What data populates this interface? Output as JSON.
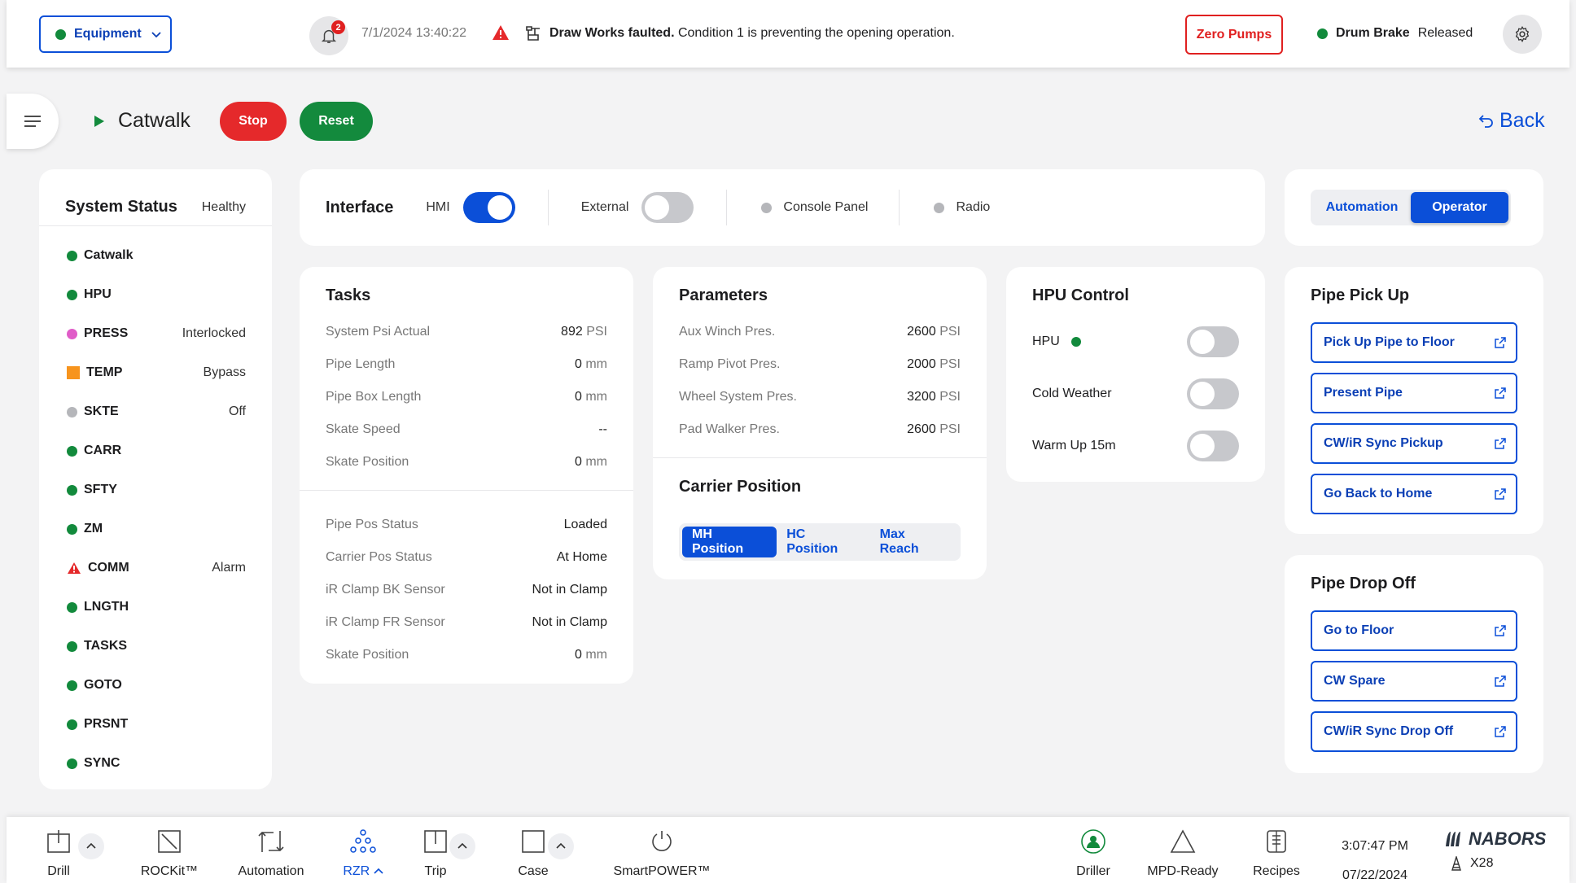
{
  "header": {
    "equipment_label": "Equipment",
    "notification_count": "2",
    "timestamp": "7/1/2024  13:40:22",
    "alert_title": "Draw Works faulted.",
    "alert_message": " Condition 1 is preventing the opening operation.",
    "zero_pumps": "Zero Pumps",
    "drum_brake_label": "Drum Brake",
    "drum_brake_state": "Released"
  },
  "page": {
    "title": "Catwalk",
    "stop": "Stop",
    "reset": "Reset",
    "back": "Back"
  },
  "system_status": {
    "title": "System Status",
    "state": "Healthy",
    "items": [
      {
        "name": "CATWALK",
        "display": "Catwalk",
        "status": "",
        "indicator": "green"
      },
      {
        "name": "HPU",
        "display": "HPU",
        "status": "",
        "indicator": "green"
      },
      {
        "name": "PRESS",
        "display": "PRESS",
        "status": "Interlocked",
        "indicator": "magenta"
      },
      {
        "name": "TEMP",
        "display": "TEMP",
        "status": "Bypass",
        "indicator": "orange-square"
      },
      {
        "name": "SKTE",
        "display": "SKTE",
        "status": "Off",
        "indicator": "gray"
      },
      {
        "name": "CARR",
        "display": "CARR",
        "status": "",
        "indicator": "green"
      },
      {
        "name": "SFTY",
        "display": "SFTY",
        "status": "",
        "indicator": "green"
      },
      {
        "name": "ZM",
        "display": "ZM",
        "status": "",
        "indicator": "green"
      },
      {
        "name": "COMM",
        "display": "COMM",
        "status": "Alarm",
        "indicator": "red-triangle"
      },
      {
        "name": "LNGTH",
        "display": "LNGTH",
        "status": "",
        "indicator": "green"
      },
      {
        "name": "TASKS",
        "display": "TASKS",
        "status": "",
        "indicator": "green"
      },
      {
        "name": "GOTO",
        "display": "GOTO",
        "status": "",
        "indicator": "green"
      },
      {
        "name": "PRSNT",
        "display": "PRSNT",
        "status": "",
        "indicator": "green"
      },
      {
        "name": "SYNC",
        "display": "SYNC",
        "status": "",
        "indicator": "green"
      }
    ]
  },
  "interface": {
    "title": "Interface",
    "hmi_label": "HMI",
    "hmi_on": true,
    "external_label": "External",
    "external_on": false,
    "console_label": "Console Panel",
    "radio_label": "Radio"
  },
  "mode": {
    "automation": "Automation",
    "operator": "Operator",
    "active": "Operator"
  },
  "tasks": {
    "title": "Tasks",
    "rows1": [
      {
        "k": "System Psi Actual",
        "v": "892",
        "u": "PSI"
      },
      {
        "k": "Pipe Length",
        "v": "0",
        "u": "mm"
      },
      {
        "k": "Pipe Box Length",
        "v": "0",
        "u": "mm"
      },
      {
        "k": "Skate Speed",
        "v": "--",
        "u": ""
      },
      {
        "k": "Skate Position",
        "v": "0",
        "u": "mm"
      }
    ],
    "rows2": [
      {
        "k": "Pipe Pos Status",
        "v": "Loaded",
        "u": ""
      },
      {
        "k": "Carrier Pos Status",
        "v": "At Home",
        "u": ""
      },
      {
        "k": "iR Clamp BK Sensor",
        "v": "Not in Clamp",
        "u": ""
      },
      {
        "k": "iR Clamp FR Sensor",
        "v": "Not in Clamp",
        "u": ""
      },
      {
        "k": "Skate Position",
        "v": "0",
        "u": "mm"
      }
    ]
  },
  "parameters": {
    "title": "Parameters",
    "rows": [
      {
        "k": "Aux Winch Pres.",
        "v": "2600",
        "u": "PSI"
      },
      {
        "k": "Ramp Pivot Pres.",
        "v": "2000",
        "u": "PSI"
      },
      {
        "k": "Wheel System Pres.",
        "v": "3200",
        "u": "PSI"
      },
      {
        "k": "Pad Walker Pres.",
        "v": "2600",
        "u": "PSI"
      }
    ],
    "carrier_title": "Carrier Position",
    "carrier_options": [
      "MH Position",
      "HC Position",
      "Max Reach"
    ],
    "carrier_active": "MH Position"
  },
  "hpu": {
    "title": "HPU Control",
    "rows": [
      {
        "label": "HPU",
        "on": false
      },
      {
        "label": "Cold Weather",
        "on": false
      },
      {
        "label": "Warm Up 15m",
        "on": false
      }
    ]
  },
  "pick_up": {
    "title": "Pipe Pick Up",
    "buttons": [
      "Pick Up Pipe to Floor",
      "Present Pipe",
      "CW/iR Sync Pickup",
      "Go Back to Home"
    ]
  },
  "drop_off": {
    "title": "Pipe Drop Off",
    "buttons": [
      "Go to Floor",
      "CW Spare",
      "CW/iR Sync Drop Off"
    ]
  },
  "bottom": {
    "items": [
      "Drill",
      "ROCKit™",
      "Automation",
      "RZR",
      "Trip",
      "Case",
      "SmartPOWER™",
      "Driller",
      "MPD-Ready",
      "Recipes"
    ],
    "time": "3:07:47 PM",
    "date": "07/22/2024",
    "brand": "NABORS",
    "rig": "X28"
  },
  "colors": {
    "accent": "#0b4fd8",
    "green": "#128a3c",
    "red": "#e5292b",
    "orange": "#f7941d",
    "magenta": "#e05cc8"
  }
}
